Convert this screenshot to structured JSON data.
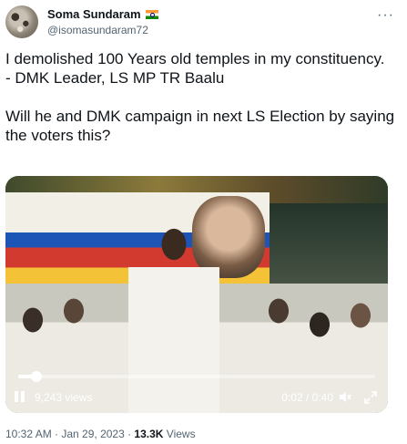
{
  "author": {
    "name": "Soma Sundaram",
    "handle": "@isomasundaram72",
    "flag_icon": "india-flag-icon"
  },
  "tweet": {
    "text": "I demolished 100 Years old temples in my constituency.\n- DMK Leader, LS MP TR Baalu\n\nWill he and DMK campaign in next LS Election by saying the voters this?"
  },
  "video": {
    "views": "9,243 views",
    "time": "0:02 / 0:40",
    "progress_fraction": 0.05
  },
  "meta": {
    "timestamp": "10:32 AM · Jan 29, 2023 · ",
    "view_count": "13.3K",
    "views_label": " Views"
  },
  "colors": {
    "text": "#0f1419",
    "secondary": "#536471"
  }
}
